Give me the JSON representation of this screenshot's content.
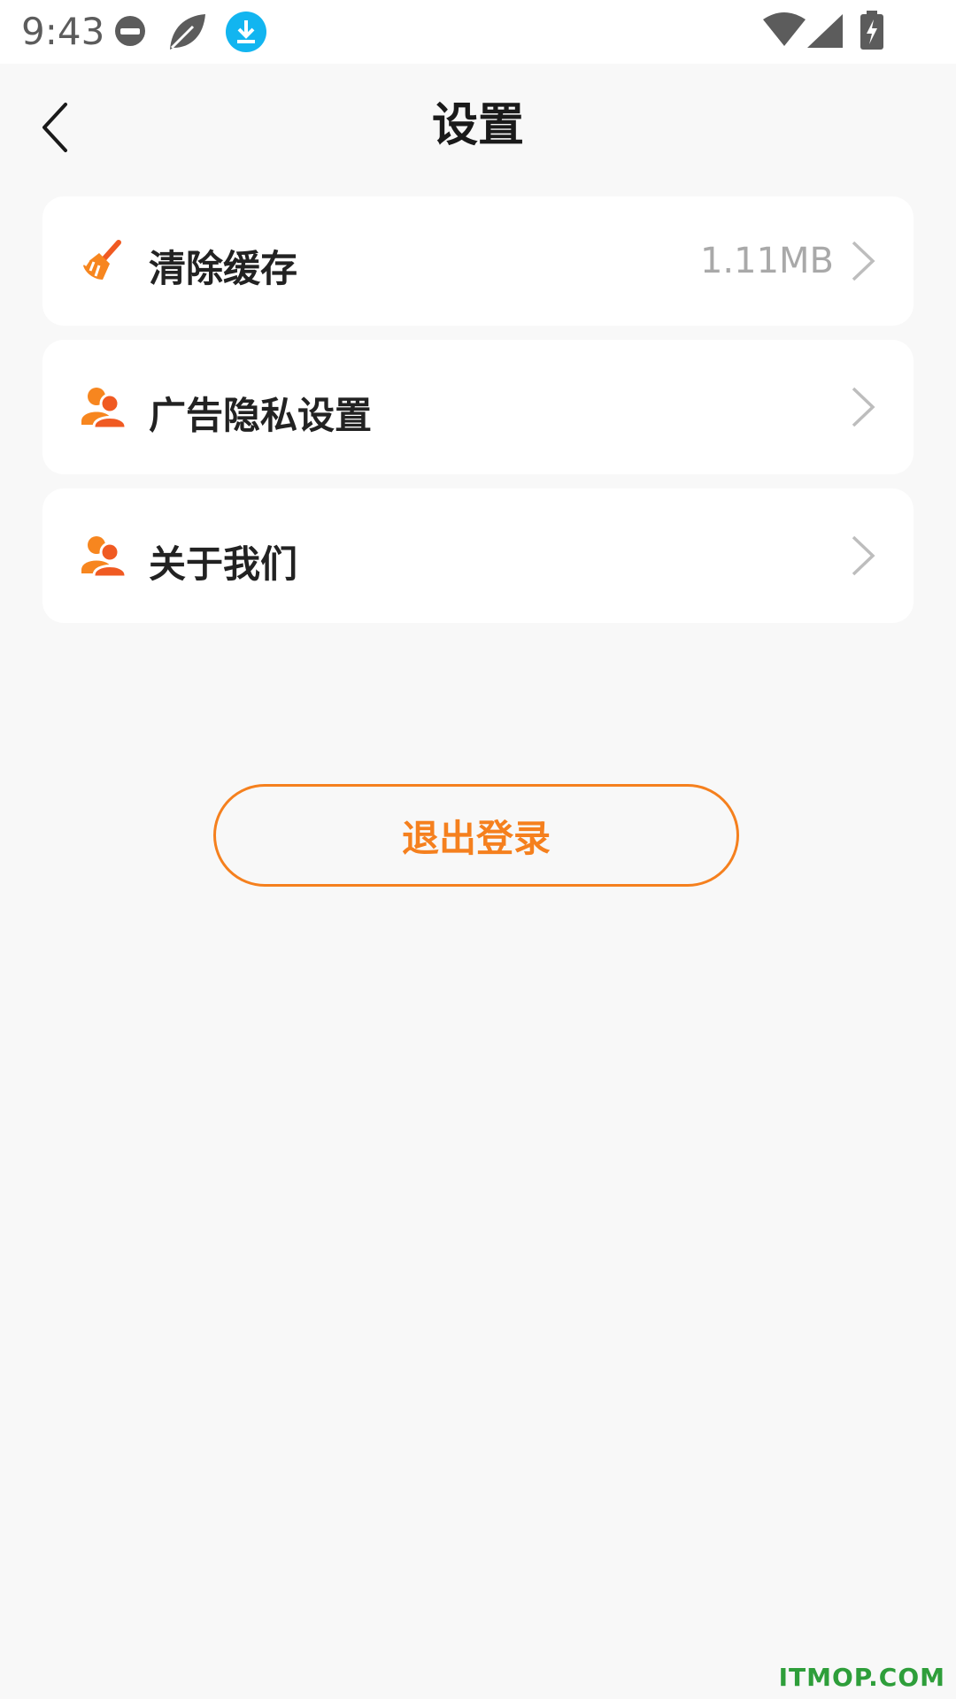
{
  "status_bar": {
    "time": "9:43",
    "icons": [
      "minus-circle-icon",
      "leaf-icon",
      "download-icon",
      "wifi-icon",
      "signal-icon",
      "battery-charging-icon"
    ],
    "download_icon_color": "#12b5f0"
  },
  "header": {
    "title": "设置",
    "back_icon": "chevron-left-icon"
  },
  "settings": [
    {
      "label": "清除缓存",
      "value": "1.11MB",
      "icon": "broom-icon"
    },
    {
      "label": "广告隐私设置",
      "value": "",
      "icon": "users-icon"
    },
    {
      "label": "关于我们",
      "value": "",
      "icon": "users-icon"
    }
  ],
  "logout": {
    "label": "退出登录"
  },
  "colors": {
    "accent": "#f5801e",
    "background": "#f8f8f8",
    "card": "#ffffff"
  },
  "watermark": "ITMOP.COM"
}
